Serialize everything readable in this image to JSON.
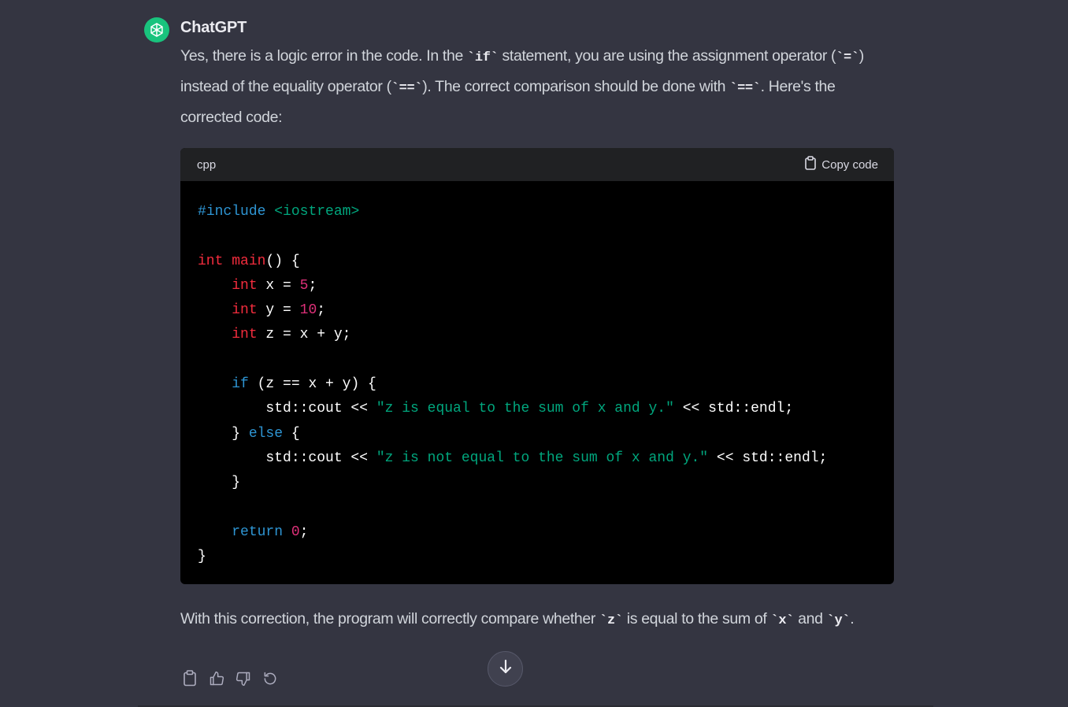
{
  "message": {
    "author": "ChatGPT",
    "avatar_icon": "openai-logo-icon",
    "avatar_color": "#19c37d",
    "intro": {
      "t1": "Yes, there is a logic error in the code. In the ",
      "c1": "`if`",
      "t2": " statement, you are using the assignment operator (",
      "c2": "`=`",
      "t3": ") instead of the equality operator (",
      "c3": "`==`",
      "t4": "). The correct comparison should be done with ",
      "c4": "`==`",
      "t5": ". Here's the corrected code:"
    },
    "code_block": {
      "language": "cpp",
      "copy_label": "Copy code",
      "copy_icon": "clipboard-icon",
      "lines": [
        [
          [
            "pp",
            "#"
          ],
          [
            "pp",
            "include"
          ],
          [
            "plain",
            " "
          ],
          [
            "inc",
            "<iostream>"
          ]
        ],
        [],
        [
          [
            "type",
            "int"
          ],
          [
            "plain",
            " "
          ],
          [
            "fn",
            "main"
          ],
          [
            "plain",
            "() {"
          ]
        ],
        [
          [
            "plain",
            "    "
          ],
          [
            "type",
            "int"
          ],
          [
            "plain",
            " x = "
          ],
          [
            "num",
            "5"
          ],
          [
            "plain",
            ";"
          ]
        ],
        [
          [
            "plain",
            "    "
          ],
          [
            "type",
            "int"
          ],
          [
            "plain",
            " y = "
          ],
          [
            "num",
            "10"
          ],
          [
            "plain",
            ";"
          ]
        ],
        [
          [
            "plain",
            "    "
          ],
          [
            "type",
            "int"
          ],
          [
            "plain",
            " z = x + y;"
          ]
        ],
        [],
        [
          [
            "plain",
            "    "
          ],
          [
            "ctrl",
            "if"
          ],
          [
            "plain",
            " (z == x + y) {"
          ]
        ],
        [
          [
            "plain",
            "        std::cout << "
          ],
          [
            "str",
            "\"z is equal to the sum of x and y.\""
          ],
          [
            "plain",
            " << std::endl;"
          ]
        ],
        [
          [
            "plain",
            "    } "
          ],
          [
            "ctrl",
            "else"
          ],
          [
            "plain",
            " {"
          ]
        ],
        [
          [
            "plain",
            "        std::cout << "
          ],
          [
            "str",
            "\"z is not equal to the sum of x and y.\""
          ],
          [
            "plain",
            " << std::endl;"
          ]
        ],
        [
          [
            "plain",
            "    }"
          ]
        ],
        [],
        [
          [
            "plain",
            "    "
          ],
          [
            "ctrl",
            "return"
          ],
          [
            "plain",
            " "
          ],
          [
            "num",
            "0"
          ],
          [
            "plain",
            ";"
          ]
        ],
        [
          [
            "plain",
            "}"
          ]
        ]
      ]
    },
    "outro": {
      "t1": "With this correction, the program will correctly compare whether ",
      "c1": "`z`",
      "t2": " is equal to the sum of ",
      "c2": "`x`",
      "t3": " and ",
      "c3": "`y`",
      "t4": "."
    },
    "actions": [
      {
        "name": "copy-message-button",
        "icon": "clipboard-icon"
      },
      {
        "name": "thumbs-up-button",
        "icon": "thumbs-up-icon"
      },
      {
        "name": "thumbs-down-button",
        "icon": "thumbs-down-icon"
      },
      {
        "name": "regenerate-button",
        "icon": "refresh-icon"
      }
    ]
  },
  "scroll_button_icon": "arrow-down-icon",
  "colors": {
    "background": "#343541",
    "code_bg": "#000000",
    "code_header_bg": "#202123",
    "keyword_blue": "#2e95d3",
    "string_green": "#00a67d",
    "type_red": "#f22c3d",
    "number_pink": "#df3079"
  }
}
